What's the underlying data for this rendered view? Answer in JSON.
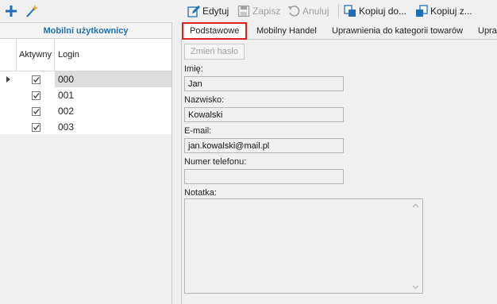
{
  "left_toolbar": {
    "add_icon": "plus-icon",
    "wizard_icon": "magic-wand-icon"
  },
  "users_panel": {
    "title": "Mobilni użytkownicy",
    "columns": {
      "active": "Aktywny",
      "login": "Login"
    },
    "rows": [
      {
        "login": "000",
        "active": true,
        "selected": true
      },
      {
        "login": "001",
        "active": true,
        "selected": false
      },
      {
        "login": "002",
        "active": true,
        "selected": false
      },
      {
        "login": "003",
        "active": true,
        "selected": false
      }
    ]
  },
  "toolbar": {
    "edit": "Edytuj",
    "save": "Zapisz",
    "cancel": "Anuluj",
    "copy_to": "Kopiuj do...",
    "copy_from": "Kopiuj z..."
  },
  "tabs": [
    {
      "label": "Podstawowe",
      "active": true
    },
    {
      "label": "Mobilny Handel",
      "active": false
    },
    {
      "label": "Uprawnienia do kategorii towarów",
      "active": false
    },
    {
      "label": "Upra",
      "active": false
    }
  ],
  "form": {
    "change_password": "Zmień hasło",
    "first_name_label": "Imię:",
    "first_name": "Jan",
    "last_name_label": "Nazwisko:",
    "last_name": "Kowalski",
    "email_label": "E-mail:",
    "email": "jan.kowalski@mail.pl",
    "phone_label": "Numer telefonu:",
    "phone": "",
    "note_label": "Notatka:",
    "note": ""
  },
  "colors": {
    "header_text": "#1f6fb8",
    "active_tab_border": "#e02020",
    "add_icon": "#1f6fb8"
  }
}
